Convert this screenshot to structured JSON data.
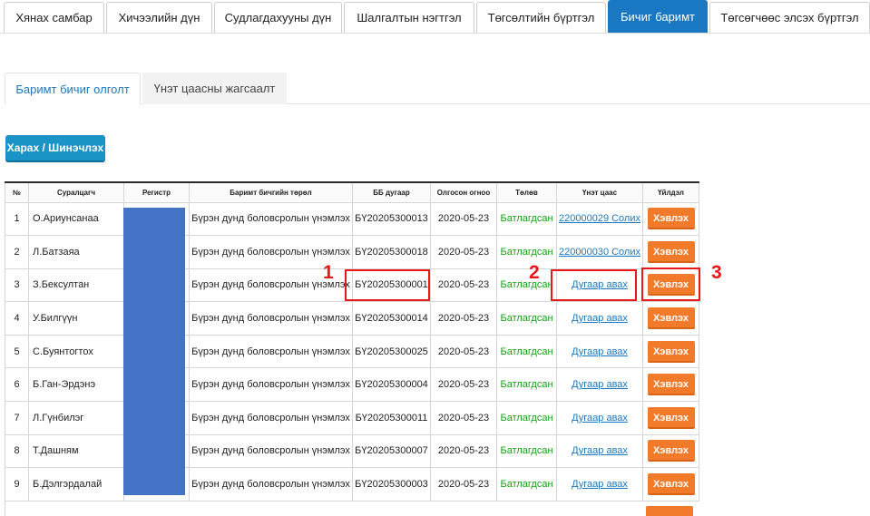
{
  "top_tabs": [
    {
      "label": "Хянах самбар",
      "active": false
    },
    {
      "label": "Хичээлийн дүн",
      "active": false
    },
    {
      "label": "Судлагдахууны дүн",
      "active": false
    },
    {
      "label": "Шалгалтын нэгтгэл",
      "active": false
    },
    {
      "label": "Төгсөлтийн бүртгэл",
      "active": false
    },
    {
      "label": "Бичиг баримт",
      "active": true
    },
    {
      "label": "Төгсөгчөөс элсэх бүртгэл",
      "active": false
    }
  ],
  "sub_tabs": [
    {
      "label": "Баримт бичиг олголт",
      "active": true
    },
    {
      "label": "Үнэт цаасны жагсаалт",
      "active": false
    }
  ],
  "refresh_button": "Харах / Шинэчлэх",
  "table": {
    "headers": [
      "№",
      "Суралцагч",
      "Регистр",
      "Баримт бичгийн төрөл",
      "ББ дугаар",
      "Олгосон огноо",
      "Төлөв",
      "Үнэт цаас",
      "Үйлдэл"
    ],
    "rows": [
      {
        "num": "1",
        "name": "О.Ариунсанаа",
        "register": "",
        "doc_type": "Бүрэн дунд боловсролын үнэмлэх",
        "doc_no": "БҮ20205300013",
        "date": "2020-05-23",
        "status": "Батлагдсан",
        "price": "220000029 Солих",
        "action": "Хэвлэх"
      },
      {
        "num": "2",
        "name": "Л.Батзаяа",
        "register": "",
        "doc_type": "Бүрэн дунд боловсролын үнэмлэх",
        "doc_no": "БҮ20205300018",
        "date": "2020-05-23",
        "status": "Батлагдсан",
        "price": "220000030 Солих",
        "action": "Хэвлэх"
      },
      {
        "num": "3",
        "name": "З.Бексултан",
        "register": "",
        "doc_type": "Бүрэн дунд боловсролын үнэмлэх",
        "doc_no": "БҮ20205300001",
        "date": "2020-05-23",
        "status": "Батлагдсан",
        "price": "Дугаар авах",
        "action": "Хэвлэх"
      },
      {
        "num": "4",
        "name": "У.Билгүүн",
        "register": "",
        "doc_type": "Бүрэн дунд боловсролын үнэмлэх",
        "doc_no": "БҮ20205300014",
        "date": "2020-05-23",
        "status": "Батлагдсан",
        "price": "Дугаар авах",
        "action": "Хэвлэх"
      },
      {
        "num": "5",
        "name": "С.Буянтогтох",
        "register": "",
        "doc_type": "Бүрэн дунд боловсролын үнэмлэх",
        "doc_no": "БҮ20205300025",
        "date": "2020-05-23",
        "status": "Батлагдсан",
        "price": "Дугаар авах",
        "action": "Хэвлэх"
      },
      {
        "num": "6",
        "name": "Б.Ган-Эрдэнэ",
        "register": "",
        "doc_type": "Бүрэн дунд боловсролын үнэмлэх",
        "doc_no": "БҮ20205300004",
        "date": "2020-05-23",
        "status": "Батлагдсан",
        "price": "Дугаар авах",
        "action": "Хэвлэх"
      },
      {
        "num": "7",
        "name": "Л.Гүнбилэг",
        "register": "",
        "doc_type": "Бүрэн дунд боловсролын үнэмлэх",
        "doc_no": "БҮ20205300011",
        "date": "2020-05-23",
        "status": "Батлагдсан",
        "price": "Дугаар авах",
        "action": "Хэвлэх"
      },
      {
        "num": "8",
        "name": "Т.Дашням",
        "register": "",
        "doc_type": "Бүрэн дунд боловсролын үнэмлэх",
        "doc_no": "БҮ20205300007",
        "date": "2020-05-23",
        "status": "Батлагдсан",
        "price": "Дугаар авах",
        "action": "Хэвлэх"
      },
      {
        "num": "9",
        "name": "Б.Дэлгэрдалай",
        "register": "",
        "doc_type": "Бүрэн дунд боловсролын үнэмлэх",
        "doc_no": "БҮ20205300003",
        "date": "2020-05-23",
        "status": "Батлагдсан",
        "price": "Дугаар авах",
        "action": "Хэвлэх"
      }
    ]
  },
  "callouts": [
    "1",
    "2",
    "3"
  ],
  "colors": {
    "accent": "#1a78c2",
    "action": "#f27a2b",
    "approved": "#14a014",
    "callout": "#e81818",
    "redaction": "#4472c4"
  }
}
